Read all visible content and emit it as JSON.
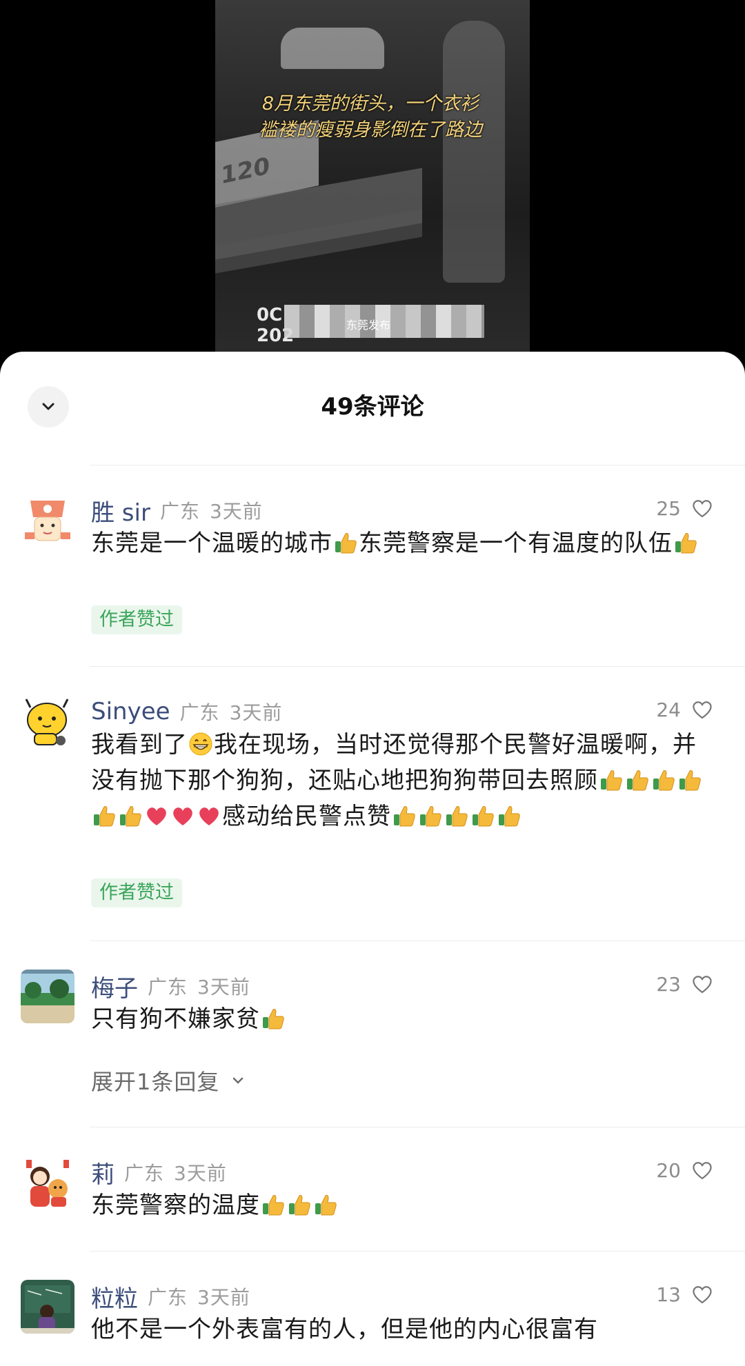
{
  "video": {
    "caption_line1": "8月东莞的街头，一个衣衫",
    "caption_line2": "褴褛的瘦弱身影倒在了路边",
    "sign_text": "120",
    "timestamp_line1": "0C",
    "timestamp_line2": "202",
    "watermark": "东莞发布"
  },
  "sheet": {
    "title": "49条评论",
    "collapse_icon": "chevron-down-icon"
  },
  "comments": [
    {
      "name": "胜 sir",
      "location": "广东",
      "time": "3天前",
      "likes": "25",
      "text_parts": [
        "东莞是一个温暖的城市",
        "东莞警察是一个有温度的队伍"
      ],
      "badge": "作者赞过"
    },
    {
      "name": "Sinyee",
      "location": "广东",
      "time": "3天前",
      "likes": "24",
      "text_parts": [
        "我看到了",
        "我在现场，当时还觉得那个民警好温暖啊，并没有抛下那个狗狗，还贴心地把狗狗带回去照顾",
        "感动给民警点赞"
      ],
      "badge": "作者赞过"
    },
    {
      "name": "梅子",
      "location": "广东",
      "time": "3天前",
      "likes": "23",
      "text_parts": [
        "只有狗不嫌家贫"
      ],
      "reply_expand": "展开1条回复"
    },
    {
      "name": "莉",
      "location": "广东",
      "time": "3天前",
      "likes": "20",
      "text_parts": [
        "东莞警察的温度"
      ]
    },
    {
      "name": "粒粒",
      "location": "广东",
      "time": "3天前",
      "likes": "13",
      "text_parts": [
        "他不是一个外表富有的人，但是他的内心很富有"
      ]
    }
  ],
  "colors": {
    "name": "#3b4d7a",
    "meta": "#9c9c9c",
    "badge_bg": "#eaf6ec",
    "badge_text": "#3aa55a",
    "thumb": "#f5b93c",
    "heart_emoji": "#e8405a"
  },
  "icons": {
    "like": "heart-outline-icon",
    "thumbs_up": "thumbs-up-emoji",
    "grin": "grinning-face-emoji",
    "heart": "red-heart-emoji"
  }
}
